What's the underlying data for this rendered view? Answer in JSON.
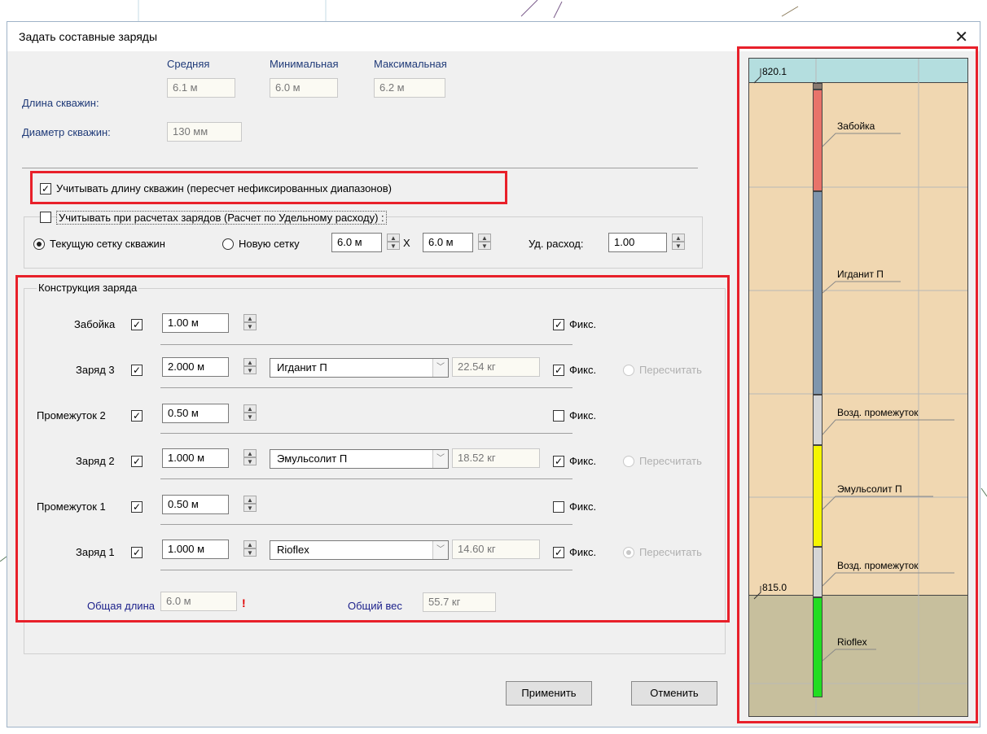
{
  "title": "Задать составные заряды",
  "close_glyph": "✕",
  "headers": {
    "avg": "Средняя",
    "min": "Минимальная",
    "max": "Максимальная"
  },
  "hole_length": {
    "label": "Длина скважин:",
    "avg": "6.1 м",
    "min": "6.0 м",
    "max": "6.2 м"
  },
  "hole_diameter": {
    "label": "Диаметр скважин:",
    "value": "130 мм"
  },
  "consider_length": {
    "label": "Учитывать длину скважин (пересчет нефиксированных диапазонов)",
    "checked": true
  },
  "consider_calc": {
    "label": "Учитывать при расчетах зарядов (Расчет по  Удельному расходу) :",
    "checked": false
  },
  "grid": {
    "current_label": "Текущую сетку скважин",
    "new_label": "Новую сетку",
    "x_value": "6.0 м",
    "times": "X",
    "y_value": "6.0 м",
    "specific_label": "Уд. расход:",
    "specific_value": "1.00",
    "selected": "current"
  },
  "construction": {
    "group_label": "Конструкция заряда",
    "fix_label": "Фикс.",
    "recalc_label": "Пересчитать",
    "rows": [
      {
        "label": "Забойка",
        "length": "1.00 м",
        "fixed": true
      },
      {
        "label": "Заряд 3",
        "length": "2.000 м",
        "explosive": "Игданит П",
        "weight": "22.54 кг",
        "fixed": true
      },
      {
        "label": "Промежуток 2",
        "length": "0.50 м",
        "fixed": false
      },
      {
        "label": "Заряд 2",
        "length": "1.000 м",
        "explosive": "Эмульсолит П",
        "weight": "18.52 кг",
        "fixed": true
      },
      {
        "label": "Промежуток 1",
        "length": "0.50 м",
        "fixed": false
      },
      {
        "label": "Заряд 1",
        "length": "1.000 м",
        "explosive": "Rioflex",
        "weight": "14.60 кг",
        "fixed": true,
        "recalc_selected": true
      }
    ],
    "total_length_label": "Общая длина",
    "total_length": "6.0 м",
    "warning": "!",
    "total_weight_label": "Общий вес",
    "total_weight": "55.7 кг"
  },
  "buttons": {
    "apply": "Применить",
    "cancel": "Отменить"
  },
  "diagram": {
    "top_level": "820.1",
    "bottom_level": "815.0",
    "labels": [
      "Забойка",
      "Игданит П",
      "Возд. промежуток",
      "Эмульсолит П",
      "Возд. промежуток",
      "Rioflex"
    ],
    "colors": {
      "stemming": "#e8736a",
      "igdanit": "#7f96ad",
      "air": "#d6d6d6",
      "emulsolit": "#f5f500",
      "rioflex": "#22dd22",
      "rock": "#f0d7b1",
      "water": "#b4dedf",
      "bottom": "#c7bf9d"
    }
  }
}
